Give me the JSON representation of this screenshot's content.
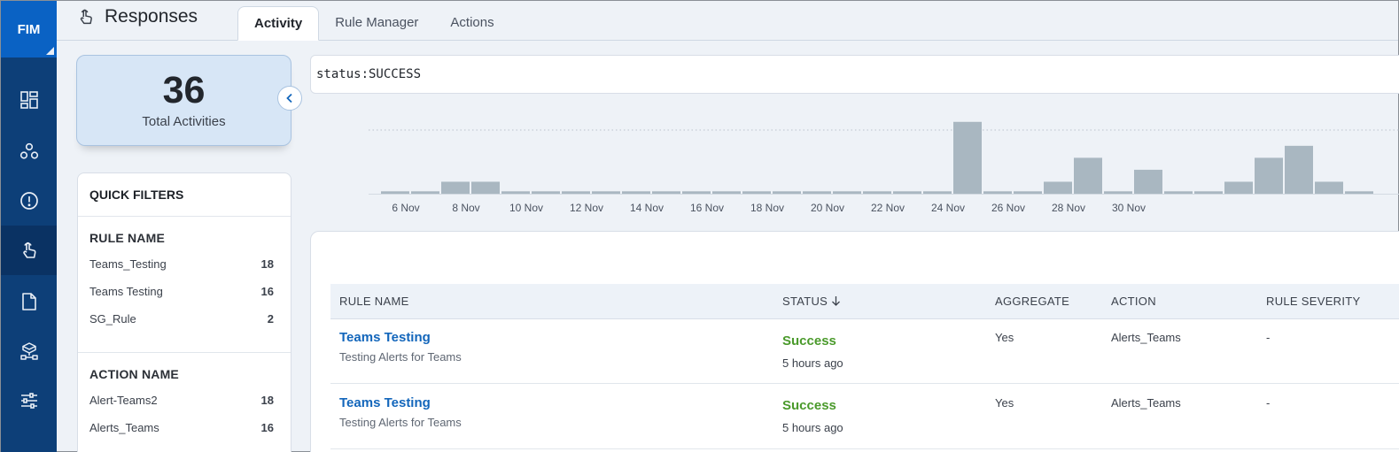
{
  "rail": {
    "brand": "FIM",
    "items": [
      {
        "name": "dashboard-icon",
        "active": false
      },
      {
        "name": "assets-icon",
        "active": false
      },
      {
        "name": "alert-icon",
        "active": false
      },
      {
        "name": "responses-icon",
        "active": true
      },
      {
        "name": "document-icon",
        "active": false
      },
      {
        "name": "network-icon",
        "active": false
      },
      {
        "name": "settings-sliders-icon",
        "active": false
      }
    ]
  },
  "header": {
    "title": "Responses",
    "tabs": [
      {
        "label": "Activity",
        "active": true
      },
      {
        "label": "Rule Manager",
        "active": false
      },
      {
        "label": "Actions",
        "active": false
      }
    ]
  },
  "summary": {
    "count": "36",
    "label": "Total Activities"
  },
  "quick_filters": {
    "title": "QUICK FILTERS",
    "rule_name": {
      "heading": "RULE NAME",
      "items": [
        {
          "label": "Teams_Testing",
          "count": "18"
        },
        {
          "label": "Teams Testing",
          "count": "16"
        },
        {
          "label": "SG_Rule",
          "count": "2"
        }
      ]
    },
    "action_name": {
      "heading": "ACTION NAME",
      "items": [
        {
          "label": "Alert-Teams2",
          "count": "18"
        },
        {
          "label": "Alerts_Teams",
          "count": "16"
        }
      ]
    }
  },
  "search": {
    "value": "status:SUCCESS"
  },
  "chart_data": {
    "type": "bar",
    "x_tick_labels": [
      "6 Nov",
      "8 Nov",
      "10 Nov",
      "12 Nov",
      "14 Nov",
      "16 Nov",
      "18 Nov",
      "20 Nov",
      "22 Nov",
      "24 Nov",
      "26 Nov",
      "28 Nov",
      "30 Nov"
    ],
    "values": [
      0.2,
      0.2,
      1,
      1,
      0.2,
      0.2,
      0.2,
      0.2,
      0.2,
      0.2,
      0.2,
      0.2,
      0.2,
      0.2,
      0.2,
      0.2,
      0.2,
      0.2,
      0.2,
      6,
      0.2,
      0.2,
      1,
      3,
      0.2,
      2,
      0.2,
      0.2,
      1,
      3,
      4,
      1,
      0.2
    ],
    "ylim": [
      0,
      6.5
    ],
    "grid": "dotted-top",
    "bar_color": "#a9b7c1"
  },
  "table": {
    "columns": {
      "rule_name": "RULE NAME",
      "status": "STATUS",
      "aggregate": "AGGREGATE",
      "action": "ACTION",
      "severity": "RULE SEVERITY"
    },
    "rows": [
      {
        "rule": "Teams Testing",
        "description": "Testing Alerts for Teams",
        "status": "Success",
        "time": "5 hours ago",
        "aggregate": "Yes",
        "action": "Alerts_Teams",
        "severity": "-"
      },
      {
        "rule": "Teams Testing",
        "description": "Testing Alerts for Teams",
        "status": "Success",
        "time": "5 hours ago",
        "aggregate": "Yes",
        "action": "Alerts_Teams",
        "severity": "-"
      }
    ]
  }
}
